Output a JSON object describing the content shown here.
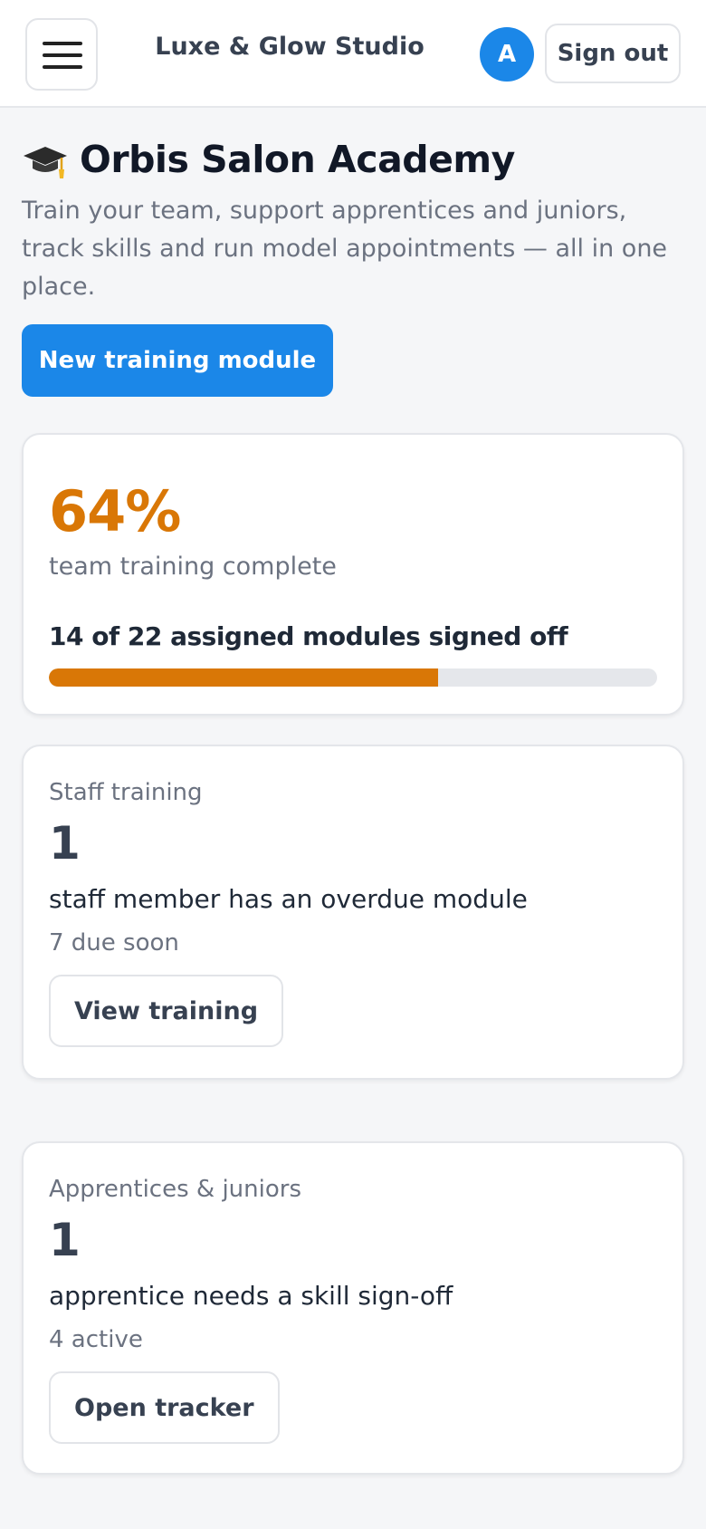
{
  "header": {
    "brand": "Luxe & Glow Studio",
    "avatar_initial": "A",
    "signout_label": "Sign out",
    "menu_icon": "hamburger-icon"
  },
  "page": {
    "title": "Orbis Salon Academy",
    "title_icon": "graduation-cap-icon",
    "subtitle": "Train your team, support apprentices and juniors, track skills and run model appointments — all in one place.",
    "primary_button": "New training module"
  },
  "progress_card": {
    "percent": "64%",
    "percent_label": "team training complete",
    "modules_text": "14 of 22 assigned modules signed off",
    "progress_fraction": 0.64
  },
  "staff_card": {
    "kicker": "Staff training",
    "count": "1",
    "description": "staff member has an overdue module",
    "meta": "7 due soon",
    "button": "View training"
  },
  "apprentices_card": {
    "kicker": "Apprentices & juniors",
    "count": "1",
    "description": "apprentice needs a skill sign-off",
    "meta": "4 active",
    "button": "Open tracker"
  },
  "colors": {
    "primary": "#1b87e8",
    "progress_accent": "#d97706",
    "progress_track": "#e5e7eb",
    "background": "#f5f6f8"
  }
}
